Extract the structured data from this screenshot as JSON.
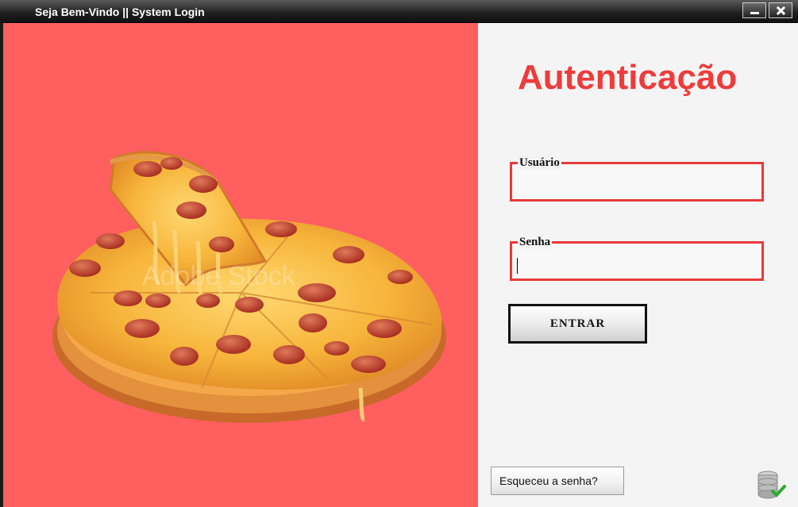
{
  "window": {
    "title": "Seja Bem-Vindo || System Login",
    "minimize_icon": "minimize-icon",
    "close_icon": "close-icon"
  },
  "login": {
    "heading": "Autenticação",
    "username_label": "Usuário",
    "username_value": "",
    "password_label": "Senha",
    "password_value": "",
    "submit_label": "ENTRAR",
    "forgot_label": "Esqueceu a senha?"
  },
  "image": {
    "description_icon": "pizza-image",
    "watermark": "Adobe Stock"
  },
  "status": {
    "icon": "database-check-icon"
  },
  "colors": {
    "left_panel_bg": "#ff5f5f",
    "accent_red": "#ef3b3b"
  }
}
